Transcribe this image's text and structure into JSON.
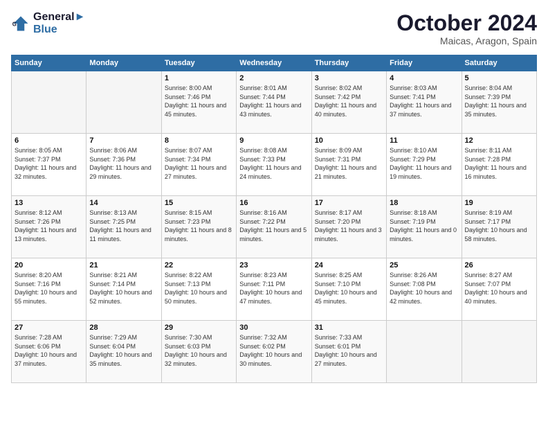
{
  "header": {
    "logo_line1": "General",
    "logo_line2": "Blue",
    "month": "October 2024",
    "location": "Maicas, Aragon, Spain"
  },
  "weekdays": [
    "Sunday",
    "Monday",
    "Tuesday",
    "Wednesday",
    "Thursday",
    "Friday",
    "Saturday"
  ],
  "weeks": [
    [
      {
        "day": "",
        "sunrise": "",
        "sunset": "",
        "daylight": "",
        "empty": true
      },
      {
        "day": "",
        "sunrise": "",
        "sunset": "",
        "daylight": "",
        "empty": true
      },
      {
        "day": "1",
        "sunrise": "Sunrise: 8:00 AM",
        "sunset": "Sunset: 7:46 PM",
        "daylight": "Daylight: 11 hours and 45 minutes."
      },
      {
        "day": "2",
        "sunrise": "Sunrise: 8:01 AM",
        "sunset": "Sunset: 7:44 PM",
        "daylight": "Daylight: 11 hours and 43 minutes."
      },
      {
        "day": "3",
        "sunrise": "Sunrise: 8:02 AM",
        "sunset": "Sunset: 7:42 PM",
        "daylight": "Daylight: 11 hours and 40 minutes."
      },
      {
        "day": "4",
        "sunrise": "Sunrise: 8:03 AM",
        "sunset": "Sunset: 7:41 PM",
        "daylight": "Daylight: 11 hours and 37 minutes."
      },
      {
        "day": "5",
        "sunrise": "Sunrise: 8:04 AM",
        "sunset": "Sunset: 7:39 PM",
        "daylight": "Daylight: 11 hours and 35 minutes."
      }
    ],
    [
      {
        "day": "6",
        "sunrise": "Sunrise: 8:05 AM",
        "sunset": "Sunset: 7:37 PM",
        "daylight": "Daylight: 11 hours and 32 minutes."
      },
      {
        "day": "7",
        "sunrise": "Sunrise: 8:06 AM",
        "sunset": "Sunset: 7:36 PM",
        "daylight": "Daylight: 11 hours and 29 minutes."
      },
      {
        "day": "8",
        "sunrise": "Sunrise: 8:07 AM",
        "sunset": "Sunset: 7:34 PM",
        "daylight": "Daylight: 11 hours and 27 minutes."
      },
      {
        "day": "9",
        "sunrise": "Sunrise: 8:08 AM",
        "sunset": "Sunset: 7:33 PM",
        "daylight": "Daylight: 11 hours and 24 minutes."
      },
      {
        "day": "10",
        "sunrise": "Sunrise: 8:09 AM",
        "sunset": "Sunset: 7:31 PM",
        "daylight": "Daylight: 11 hours and 21 minutes."
      },
      {
        "day": "11",
        "sunrise": "Sunrise: 8:10 AM",
        "sunset": "Sunset: 7:29 PM",
        "daylight": "Daylight: 11 hours and 19 minutes."
      },
      {
        "day": "12",
        "sunrise": "Sunrise: 8:11 AM",
        "sunset": "Sunset: 7:28 PM",
        "daylight": "Daylight: 11 hours and 16 minutes."
      }
    ],
    [
      {
        "day": "13",
        "sunrise": "Sunrise: 8:12 AM",
        "sunset": "Sunset: 7:26 PM",
        "daylight": "Daylight: 11 hours and 13 minutes."
      },
      {
        "day": "14",
        "sunrise": "Sunrise: 8:13 AM",
        "sunset": "Sunset: 7:25 PM",
        "daylight": "Daylight: 11 hours and 11 minutes."
      },
      {
        "day": "15",
        "sunrise": "Sunrise: 8:15 AM",
        "sunset": "Sunset: 7:23 PM",
        "daylight": "Daylight: 11 hours and 8 minutes."
      },
      {
        "day": "16",
        "sunrise": "Sunrise: 8:16 AM",
        "sunset": "Sunset: 7:22 PM",
        "daylight": "Daylight: 11 hours and 5 minutes."
      },
      {
        "day": "17",
        "sunrise": "Sunrise: 8:17 AM",
        "sunset": "Sunset: 7:20 PM",
        "daylight": "Daylight: 11 hours and 3 minutes."
      },
      {
        "day": "18",
        "sunrise": "Sunrise: 8:18 AM",
        "sunset": "Sunset: 7:19 PM",
        "daylight": "Daylight: 11 hours and 0 minutes."
      },
      {
        "day": "19",
        "sunrise": "Sunrise: 8:19 AM",
        "sunset": "Sunset: 7:17 PM",
        "daylight": "Daylight: 10 hours and 58 minutes."
      }
    ],
    [
      {
        "day": "20",
        "sunrise": "Sunrise: 8:20 AM",
        "sunset": "Sunset: 7:16 PM",
        "daylight": "Daylight: 10 hours and 55 minutes."
      },
      {
        "day": "21",
        "sunrise": "Sunrise: 8:21 AM",
        "sunset": "Sunset: 7:14 PM",
        "daylight": "Daylight: 10 hours and 52 minutes."
      },
      {
        "day": "22",
        "sunrise": "Sunrise: 8:22 AM",
        "sunset": "Sunset: 7:13 PM",
        "daylight": "Daylight: 10 hours and 50 minutes."
      },
      {
        "day": "23",
        "sunrise": "Sunrise: 8:23 AM",
        "sunset": "Sunset: 7:11 PM",
        "daylight": "Daylight: 10 hours and 47 minutes."
      },
      {
        "day": "24",
        "sunrise": "Sunrise: 8:25 AM",
        "sunset": "Sunset: 7:10 PM",
        "daylight": "Daylight: 10 hours and 45 minutes."
      },
      {
        "day": "25",
        "sunrise": "Sunrise: 8:26 AM",
        "sunset": "Sunset: 7:08 PM",
        "daylight": "Daylight: 10 hours and 42 minutes."
      },
      {
        "day": "26",
        "sunrise": "Sunrise: 8:27 AM",
        "sunset": "Sunset: 7:07 PM",
        "daylight": "Daylight: 10 hours and 40 minutes."
      }
    ],
    [
      {
        "day": "27",
        "sunrise": "Sunrise: 7:28 AM",
        "sunset": "Sunset: 6:06 PM",
        "daylight": "Daylight: 10 hours and 37 minutes."
      },
      {
        "day": "28",
        "sunrise": "Sunrise: 7:29 AM",
        "sunset": "Sunset: 6:04 PM",
        "daylight": "Daylight: 10 hours and 35 minutes."
      },
      {
        "day": "29",
        "sunrise": "Sunrise: 7:30 AM",
        "sunset": "Sunset: 6:03 PM",
        "daylight": "Daylight: 10 hours and 32 minutes."
      },
      {
        "day": "30",
        "sunrise": "Sunrise: 7:32 AM",
        "sunset": "Sunset: 6:02 PM",
        "daylight": "Daylight: 10 hours and 30 minutes."
      },
      {
        "day": "31",
        "sunrise": "Sunrise: 7:33 AM",
        "sunset": "Sunset: 6:01 PM",
        "daylight": "Daylight: 10 hours and 27 minutes."
      },
      {
        "day": "",
        "sunrise": "",
        "sunset": "",
        "daylight": "",
        "empty": true
      },
      {
        "day": "",
        "sunrise": "",
        "sunset": "",
        "daylight": "",
        "empty": true
      }
    ]
  ]
}
